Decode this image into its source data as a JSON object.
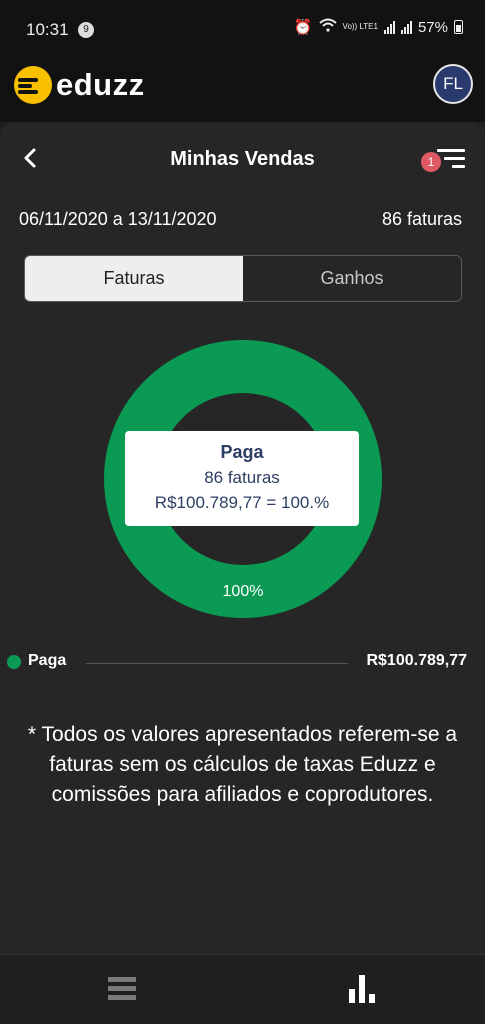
{
  "status_bar": {
    "time": "10:31",
    "notification_count": "9",
    "network_label": "Vo)) LTE1",
    "battery": "57%"
  },
  "app": {
    "logo_text": "eduzz",
    "avatar_initials": "FL"
  },
  "header": {
    "title": "Minhas Vendas",
    "filter_badge": "1"
  },
  "summary": {
    "date_range": "06/11/2020 a 13/11/2020",
    "count": "86 faturas"
  },
  "tabs": [
    {
      "label": "Faturas",
      "active": true
    },
    {
      "label": "Ganhos",
      "active": false
    }
  ],
  "chart_data": {
    "type": "pie",
    "donut": true,
    "slices": [
      {
        "label": "Paga",
        "value": 100.0,
        "amount": "R$100.789,77",
        "count": "86 faturas",
        "color": "#0a9a54"
      }
    ],
    "slice_label": "100%",
    "tooltip": {
      "title": "Paga",
      "line1": "86 faturas",
      "line2": "R$100.789,77 = 100.%"
    }
  },
  "legend": [
    {
      "label": "Paga",
      "value": "R$100.789,77",
      "color": "#0a9a54"
    }
  ],
  "note": "* Todos os valores apresentados referem-se a faturas sem os cálculos de taxas Eduzz e comissões para afiliados e coprodutores.",
  "bottom_nav": [
    {
      "icon": "list-icon",
      "active": false
    },
    {
      "icon": "bar-chart-icon",
      "active": true
    }
  ],
  "colors": {
    "accent_green": "#0a9a54",
    "brand_yellow": "#f9c000",
    "badge_red": "#e05a66",
    "tooltip_text": "#2c3e63"
  }
}
